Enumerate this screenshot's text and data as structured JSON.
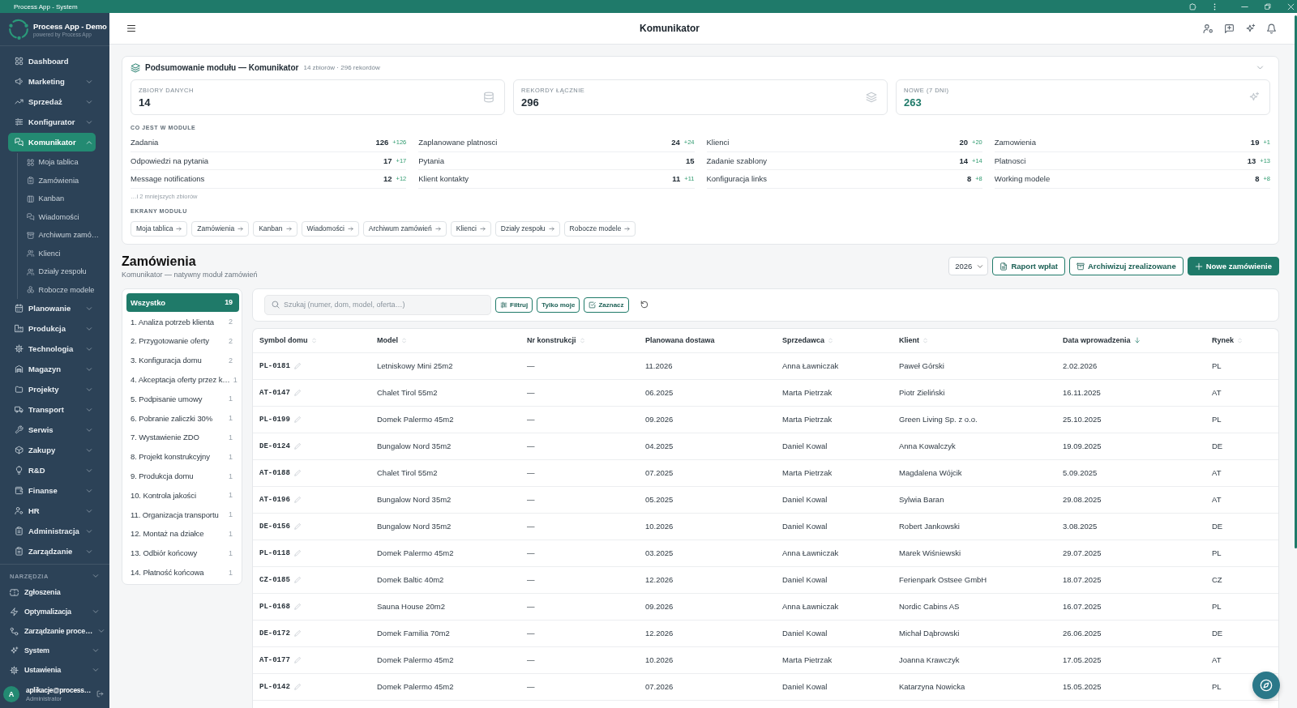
{
  "window": {
    "title": "Process App - System"
  },
  "sidebar": {
    "brand": {
      "name": "Process App - Demo",
      "tagline": "powered by Process App"
    },
    "items": [
      {
        "label": "Dashboard",
        "expandable": false,
        "expanded": false,
        "selected": false
      },
      {
        "label": "Marketing",
        "expandable": true,
        "expanded": false,
        "selected": false
      },
      {
        "label": "Sprzedaż",
        "expandable": true,
        "expanded": false,
        "selected": false
      },
      {
        "label": "Konfigurator",
        "expandable": true,
        "expanded": false,
        "selected": false
      },
      {
        "label": "Komunikator",
        "expandable": true,
        "expanded": true,
        "selected": true,
        "children": [
          {
            "label": "Moja tablica",
            "selected": false
          },
          {
            "label": "Zamówienia",
            "selected": false
          },
          {
            "label": "Kanban",
            "selected": false
          },
          {
            "label": "Wiadomości",
            "selected": false
          },
          {
            "label": "Archiwum zamó…",
            "selected": false
          },
          {
            "label": "Klienci",
            "selected": false
          },
          {
            "label": "Działy zespołu",
            "selected": false
          },
          {
            "label": "Robocze modele",
            "selected": false
          }
        ]
      },
      {
        "label": "Planowanie",
        "expandable": true,
        "expanded": false,
        "selected": false
      },
      {
        "label": "Produkcja",
        "expandable": true,
        "expanded": false,
        "selected": false
      },
      {
        "label": "Technologia",
        "expandable": true,
        "expanded": false,
        "selected": false
      },
      {
        "label": "Magazyn",
        "expandable": true,
        "expanded": false,
        "selected": false
      },
      {
        "label": "Projekty",
        "expandable": true,
        "expanded": false,
        "selected": false
      },
      {
        "label": "Transport",
        "expandable": true,
        "expanded": false,
        "selected": false
      },
      {
        "label": "Serwis",
        "expandable": true,
        "expanded": false,
        "selected": false
      },
      {
        "label": "Zakupy",
        "expandable": true,
        "expanded": false,
        "selected": false
      },
      {
        "label": "R&D",
        "expandable": true,
        "expanded": false,
        "selected": false
      },
      {
        "label": "Finanse",
        "expandable": true,
        "expanded": false,
        "selected": false
      },
      {
        "label": "HR",
        "expandable": true,
        "expanded": false,
        "selected": false
      },
      {
        "label": "Administracja",
        "expandable": true,
        "expanded": false,
        "selected": false
      },
      {
        "label": "Zarządzanie",
        "expandable": true,
        "expanded": false,
        "selected": false
      }
    ],
    "tools": {
      "title": "NARZĘDZIA",
      "items": [
        {
          "label": "Zgłoszenia",
          "expandable": false,
          "expanded": false,
          "selected": false
        },
        {
          "label": "Optymalizacja",
          "expandable": true,
          "expanded": false,
          "selected": false
        },
        {
          "label": "Zarządzanie proce…",
          "expandable": true,
          "expanded": false,
          "selected": false
        },
        {
          "label": "System",
          "expandable": true,
          "expanded": false,
          "selected": false
        },
        {
          "label": "Ustawienia",
          "expandable": true,
          "expanded": false,
          "selected": false
        }
      ]
    },
    "user": {
      "initial": "A",
      "email": "aplikacje@process…",
      "role": "Administrator"
    }
  },
  "header": {
    "title": "Komunikator"
  },
  "summary": {
    "title": "Podsumowanie modułu — Komunikator",
    "meta": "14 zbiorów · 296 rekordów",
    "stats": [
      {
        "label": "ZBIORY DANYCH",
        "value": "14",
        "highlight": false
      },
      {
        "label": "REKORDY ŁĄCZNIE",
        "value": "296",
        "highlight": false
      },
      {
        "label": "NOWE (7 DNI)",
        "value": "263",
        "highlight": true
      }
    ],
    "contents_title": "CO JEST W MODULE",
    "contents": [
      {
        "name": "Zadania",
        "count": "126",
        "delta": "+126"
      },
      {
        "name": "Zaplanowane platnosci",
        "count": "24",
        "delta": "+24"
      },
      {
        "name": "Klienci",
        "count": "20",
        "delta": "+20"
      },
      {
        "name": "Zamowienia",
        "count": "19",
        "delta": "+1"
      },
      {
        "name": "Odpowiedzi na pytania",
        "count": "17",
        "delta": "+17"
      },
      {
        "name": "Pytania",
        "count": "15"
      },
      {
        "name": "Zadanie szablony",
        "count": "14",
        "delta": "+14"
      },
      {
        "name": "Platnosci",
        "count": "13",
        "delta": "+13"
      },
      {
        "name": "Message notifications",
        "count": "12",
        "delta": "+12"
      },
      {
        "name": "Klient kontakty",
        "count": "11",
        "delta": "+11"
      },
      {
        "name": "Konfiguracja links",
        "count": "8",
        "delta": "+8"
      },
      {
        "name": "Working modele",
        "count": "8",
        "delta": "+8"
      }
    ],
    "more": "…i 2 mniejszych zbiorów",
    "screens_title": "EKRANY MODUŁU",
    "screens": [
      "Moja tablica",
      "Zamówienia",
      "Kanban",
      "Wiadomości",
      "Archiwum zamówień",
      "Klienci",
      "Działy zespołu",
      "Robocze modele"
    ]
  },
  "page": {
    "title": "Zamówienia",
    "subtitle": "Komunikator — natywny moduł zamówień",
    "year": "2026",
    "actions": [
      {
        "label": "Raport wpłat",
        "kind": "outline"
      },
      {
        "label": "Archiwizuj zrealizowane",
        "kind": "outline"
      },
      {
        "label": "Nowe zamówienie",
        "kind": "primary"
      }
    ]
  },
  "stages": [
    {
      "label": "Wszystko",
      "count": "19",
      "selected": true
    },
    {
      "label": "1. Analiza potrzeb klienta",
      "count": "2",
      "selected": false
    },
    {
      "label": "2. Przygotowanie oferty",
      "count": "2",
      "selected": false
    },
    {
      "label": "3. Konfiguracja domu",
      "count": "2",
      "selected": false
    },
    {
      "label": "4. Akceptacja oferty przez k…",
      "count": "1",
      "selected": false
    },
    {
      "label": "5. Podpisanie umowy",
      "count": "1",
      "selected": false
    },
    {
      "label": "6. Pobranie zaliczki 30%",
      "count": "1",
      "selected": false
    },
    {
      "label": "7. Wystawienie ZDO",
      "count": "1",
      "selected": false
    },
    {
      "label": "8. Projekt konstrukcyjny",
      "count": "1",
      "selected": false
    },
    {
      "label": "9. Produkcja domu",
      "count": "1",
      "selected": false
    },
    {
      "label": "10. Kontrola jakości",
      "count": "1",
      "selected": false
    },
    {
      "label": "11. Organizacja transportu",
      "count": "1",
      "selected": false
    },
    {
      "label": "12. Montaż na działce",
      "count": "1",
      "selected": false
    },
    {
      "label": "13. Odbiór końcowy",
      "count": "1",
      "selected": false
    },
    {
      "label": "14. Płatność końcowa",
      "count": "1",
      "selected": false
    }
  ],
  "toolbar": {
    "search": {
      "placeholder": "Szukaj (numer, dom, model, oferta…)"
    },
    "buttons": [
      {
        "label": "Filtruj"
      },
      {
        "label": "Tylko moje"
      },
      {
        "label": "Zaznacz"
      }
    ]
  },
  "table": {
    "columns": [
      {
        "label": "Symbol domu",
        "kind": "code",
        "sortable": true,
        "sorted": false
      },
      {
        "label": "Model",
        "kind": "text",
        "sortable": true,
        "sorted": false
      },
      {
        "label": "Nr konstrukcji",
        "kind": "text",
        "sortable": true,
        "sorted": false
      },
      {
        "label": "Planowana dostawa",
        "kind": "text",
        "sortable": false,
        "sorted": false
      },
      {
        "label": "Sprzedawca",
        "kind": "text",
        "sortable": true,
        "sorted": false
      },
      {
        "label": "Klient",
        "kind": "text",
        "sortable": true,
        "sorted": false
      },
      {
        "label": "Data wprowadzenia",
        "kind": "text",
        "sortable": true,
        "sorted": true
      },
      {
        "label": "Rynek",
        "kind": "text",
        "sortable": true,
        "sorted": false
      }
    ],
    "rows": [
      [
        "PL-0181",
        "Letniskowy Mini 25m2",
        "—",
        "11.2026",
        "Anna Ławniczak",
        "Paweł Górski",
        "2.02.2026",
        "PL"
      ],
      [
        "AT-0147",
        "Chalet Tirol 55m2",
        "—",
        "06.2025",
        "Marta Pietrzak",
        "Piotr Zieliński",
        "16.11.2025",
        "AT"
      ],
      [
        "PL-0199",
        "Domek Palermo 45m2",
        "—",
        "09.2026",
        "Marta Pietrzak",
        "Green Living Sp. z o.o.",
        "25.10.2025",
        "PL"
      ],
      [
        "DE-0124",
        "Bungalow Nord 35m2",
        "—",
        "04.2025",
        "Daniel Kowal",
        "Anna Kowalczyk",
        "19.09.2025",
        "DE"
      ],
      [
        "AT-0188",
        "Chalet Tirol 55m2",
        "—",
        "07.2025",
        "Marta Pietrzak",
        "Magdalena Wójcik",
        "5.09.2025",
        "AT"
      ],
      [
        "AT-0196",
        "Bungalow Nord 35m2",
        "—",
        "05.2025",
        "Daniel Kowal",
        "Sylwia Baran",
        "29.08.2025",
        "AT"
      ],
      [
        "DE-0156",
        "Bungalow Nord 35m2",
        "—",
        "10.2026",
        "Daniel Kowal",
        "Robert Jankowski",
        "3.08.2025",
        "DE"
      ],
      [
        "PL-0118",
        "Domek Palermo 45m2",
        "—",
        "03.2025",
        "Anna Ławniczak",
        "Marek Wiśniewski",
        "29.07.2025",
        "PL"
      ],
      [
        "CZ-0185",
        "Domek Baltic 40m2",
        "—",
        "12.2026",
        "Daniel Kowal",
        "Ferienpark Ostsee GmbH",
        "18.07.2025",
        "CZ"
      ],
      [
        "PL-0168",
        "Sauna House 20m2",
        "—",
        "09.2026",
        "Anna Ławniczak",
        "Nordic Cabins AS",
        "16.07.2025",
        "PL"
      ],
      [
        "DE-0172",
        "Domek Familia 70m2",
        "—",
        "12.2026",
        "Daniel Kowal",
        "Michał Dąbrowski",
        "26.06.2025",
        "DE"
      ],
      [
        "AT-0177",
        "Domek Palermo 45m2",
        "—",
        "10.2026",
        "Marta Pietrzak",
        "Joanna Krawczyk",
        "17.05.2025",
        "AT"
      ],
      [
        "PL-0142",
        "Domek Palermo 45m2",
        "—",
        "07.2026",
        "Daniel Kowal",
        "Katarzyna Nowicka",
        "15.05.2025",
        "PL"
      ]
    ]
  }
}
